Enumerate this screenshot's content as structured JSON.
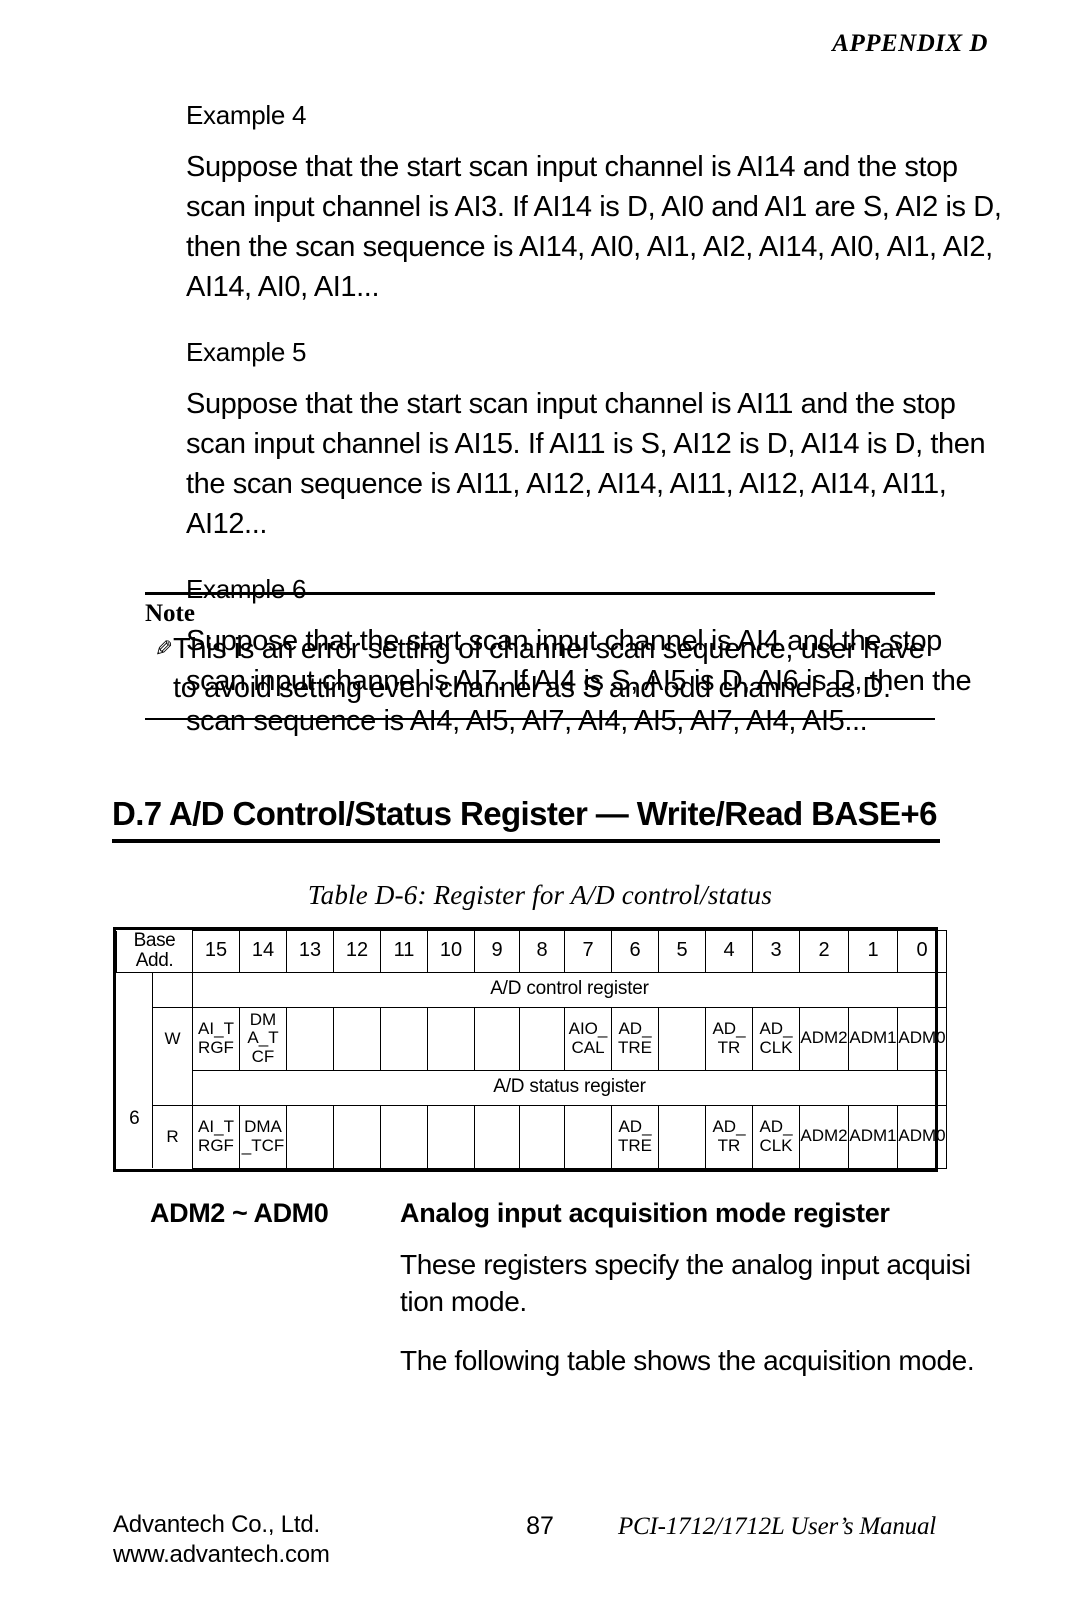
{
  "running_head": "APPENDIX D",
  "examples": [
    {
      "heading": "Example 4",
      "text": "Suppose that the start scan input channel is AI14 and the stop scan input channel is AI3. If AI14 is D, AI0 and AI1 are S, AI2 is D, then the scan sequence is AI14, AI0, AI1, AI2, AI14, AI0, AI1, AI2, AI14, AI0, AI1..."
    },
    {
      "heading": "Example 5",
      "text": "Suppose that the start scan input channel is AI11 and the stop scan input channel is AI15. If AI11 is S, AI12 is D, AI14 is D, then the scan sequence is AI11, AI12, AI14, AI11, AI12, AI14, AI11, AI12..."
    },
    {
      "heading": "Example 6",
      "text": "Suppose that the start scan input channel is AI4 and the stop scan input channel is AI7. If AI4 is S, AI5 is D, AI6 is D, then the scan sequence is AI4, AI5, AI7, AI4, AI5, AI7, AI4, AI5..."
    }
  ],
  "note": {
    "title": "Note",
    "icon": "pencil-icon",
    "text": "This is an error setting of channel scan sequence, user have to avoid setting even channel as S and odd channel as D."
  },
  "section": {
    "heading": "D.7 A/D Control/Status Register — Write/Read BASE+6"
  },
  "table": {
    "caption": "Table D-6:  Register for A/D control/status",
    "base_add_header": "Base Add.",
    "bit_headers": [
      "15",
      "14",
      "13",
      "12",
      "11",
      "10",
      "9",
      "8",
      "7",
      "6",
      "5",
      "4",
      "3",
      "2",
      "1",
      "0"
    ],
    "base_address": "6",
    "rows": [
      {
        "mode": "W",
        "title": "A/D control register",
        "cells": [
          "AI_T\nRGF",
          "DM\nA_T\nCF",
          "",
          "",
          "",
          "",
          "",
          "",
          "AIO_\nCAL",
          "AD_\nTRE",
          "",
          "AD_\nTR",
          "AD_\nCLK",
          "ADM2",
          "ADM1",
          "ADM0"
        ]
      },
      {
        "mode": "R",
        "title": "A/D status register",
        "cells": [
          "AI_T\nRGF",
          "DMA\n_TCF",
          "",
          "",
          "",
          "",
          "",
          "",
          "",
          "AD_\nTRE",
          "",
          "AD_\nTR",
          "AD_\nCLK",
          "ADM2",
          "ADM1",
          "ADM0"
        ]
      }
    ]
  },
  "adm": {
    "label": "ADM2 ~ ADM0",
    "definition": "Analog input acquisition mode register",
    "paragraph1": "These registers specify the analog input acquisi tion mode.",
    "paragraph2": "The following table shows the acquisition mode."
  },
  "footer": {
    "company": "Advantech Co., Ltd.",
    "website": "www.advantech.com",
    "page_number": "87",
    "manual": "PCI-1712/1712L User’s Manual"
  }
}
